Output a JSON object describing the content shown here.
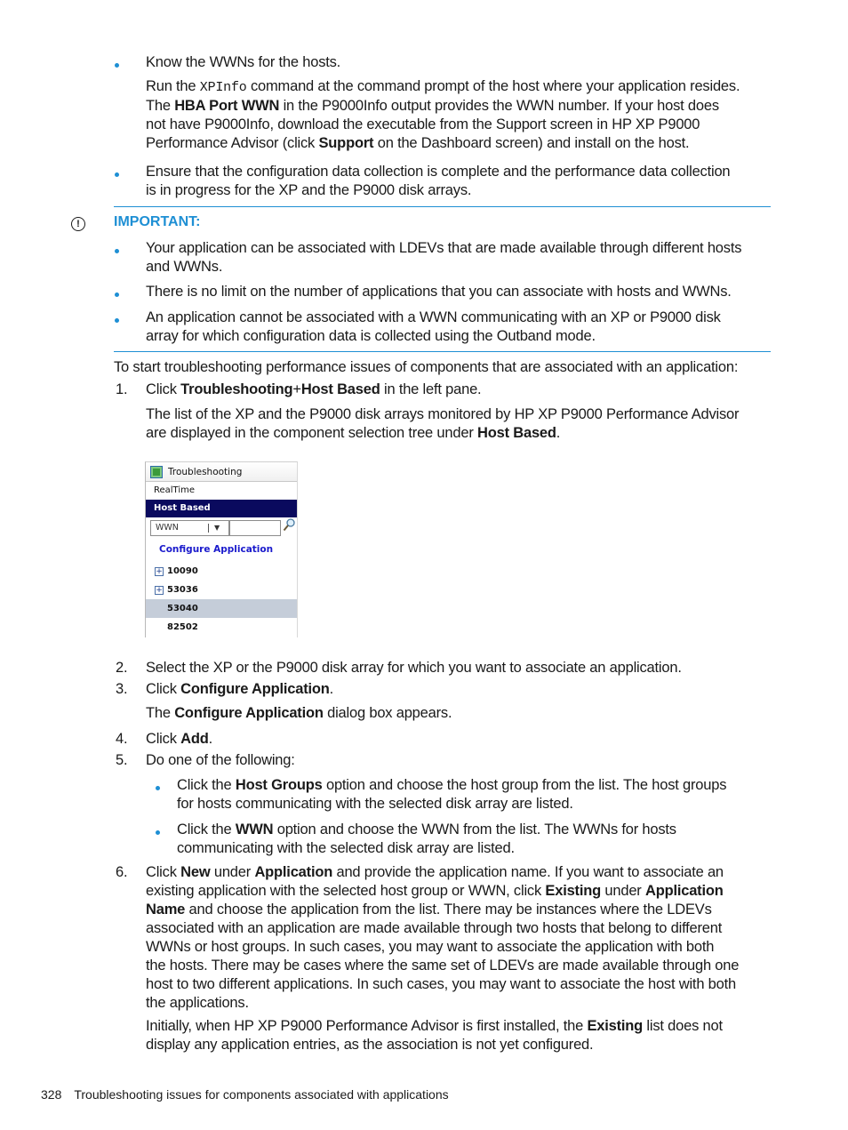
{
  "prereqs": {
    "bullet1": {
      "text": "Know the WWNs for the hosts.",
      "para_l1_a": "Run the ",
      "para_l1_code": "XPInfo",
      "para_l1_b": " command at the command prompt of the host where your application resides.",
      "para_l2_a": "The ",
      "para_l2_bold": "HBA Port WWN",
      "para_l2_b": " in the P9000Info output provides the WWN number. If your host does",
      "para_l3": "not have P9000Info, download the executable from the Support screen in HP XP P9000",
      "para_l4_a": "Performance Advisor (click ",
      "para_l4_bold": "Support",
      "para_l4_b": " on the Dashboard screen) and install on the host."
    },
    "bullet2": {
      "l1": "Ensure that the configuration data collection is complete and the performance data collection",
      "l2": "is in progress for the XP and the P9000 disk arrays."
    }
  },
  "important": {
    "icon": "exclamation-circle-icon",
    "label": "IMPORTANT:",
    "items": [
      {
        "l1": "Your application can be associated with LDEVs that are made available through different hosts",
        "l2": "and WWNs."
      },
      {
        "l1": "There is no limit on the number of applications that you can associate with hosts and WWNs.",
        "l2": ""
      },
      {
        "l1": "An application cannot be associated with a WWN communicating with an XP or P9000 disk",
        "l2": "array for which configuration data is collected using the Outband mode."
      }
    ]
  },
  "intro": "To start troubleshooting performance issues of components that are associated with an application:",
  "steps": {
    "s1": {
      "num": "1.",
      "a": "Click ",
      "bold1": "Troubleshooting",
      "plus": "+",
      "bold2": "Host Based",
      "b": " in the left pane.",
      "p_l1": "The list of the XP and the P9000 disk arrays monitored by HP XP P9000 Performance Advisor",
      "p_l2_a": "are displayed in the component selection tree under ",
      "p_l2_bold": "Host Based",
      "p_l2_b": "."
    },
    "s2": {
      "num": "2.",
      "text": "Select the XP or the P9000 disk array for which you want to associate an application."
    },
    "s3": {
      "num": "3.",
      "a": "Click ",
      "bold": "Configure Application",
      "b": ".",
      "p_a": "The ",
      "p_bold": "Configure Application",
      "p_b": " dialog box appears."
    },
    "s4": {
      "num": "4.",
      "a": "Click ",
      "bold": "Add",
      "b": "."
    },
    "s5": {
      "num": "5.",
      "text": "Do one of the following:",
      "o1_a": "Click the ",
      "o1_bold": "Host Groups",
      "o1_b": " option and choose the host group from the list. The host groups",
      "o1_l2": "for hosts communicating with the selected disk array are listed.",
      "o2_a": "Click the ",
      "o2_bold": "WWN",
      "o2_b": " option and choose the WWN from the list. The WWNs for hosts",
      "o2_l2": "communicating with the selected disk array are listed."
    },
    "s6": {
      "num": "6.",
      "l1_a": "Click ",
      "l1_b1": "New",
      "l1_c": " under ",
      "l1_b2": "Application",
      "l1_d": " and provide the application name. If you want to associate an",
      "l2_a": "existing application with the selected host group or WWN, click ",
      "l2_b1": "Existing",
      "l2_c": " under ",
      "l2_b2": "Application",
      "l3_b": "Name",
      "l3_a": " and choose the application from the list. There may be instances where the LDEVs",
      "l4": "associated with an application are made available through two hosts that belong to different",
      "l5": "WWNs or host groups. In such cases, you may want to associate the application with both",
      "l6": "the hosts. There may be cases where the same set of LDEVs are made available through one",
      "l7": "host to two different applications. In such cases, you may want to associate the host with both",
      "l8": "the applications.",
      "p_l1_a": "Initially, when HP XP P9000 Performance Advisor is first installed, the ",
      "p_l1_bold": "Existing",
      "p_l1_b": " list does not",
      "p_l2": "display any application entries, as the association is not yet configured."
    }
  },
  "screenshot": {
    "header": "Troubleshooting",
    "realtime": "RealTime",
    "host_based": "Host Based",
    "filter_value": "WWN",
    "search_value": "",
    "configure": "Configure Application",
    "tree": [
      {
        "label": "10090",
        "expandable": true,
        "selected": false
      },
      {
        "label": "53036",
        "expandable": true,
        "selected": false
      },
      {
        "label": "53040",
        "expandable": false,
        "selected": true
      },
      {
        "label": "82502",
        "expandable": false,
        "selected": false
      }
    ]
  },
  "footer": {
    "page_number": "328",
    "title": "Troubleshooting issues for components associated with applications"
  }
}
